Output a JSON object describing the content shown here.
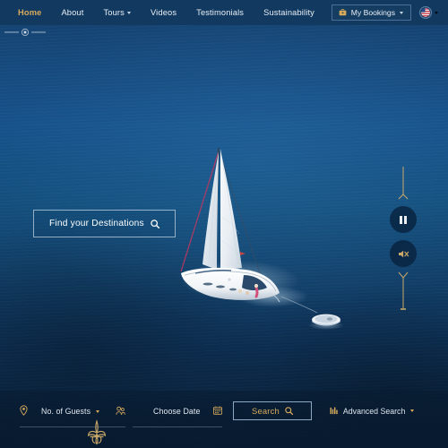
{
  "colors": {
    "nav_bg": "#123a60",
    "accent_gold": "#d6aa5c",
    "text_light": "#e8eef5",
    "ocean_light": "#17538c",
    "ocean_dark": "#0a2340",
    "border_muted": "#4a7099"
  },
  "nav": {
    "items": [
      {
        "label": "Home",
        "active": true,
        "has_dropdown": false
      },
      {
        "label": "About",
        "active": false,
        "has_dropdown": false
      },
      {
        "label": "Tours",
        "active": false,
        "has_dropdown": true
      },
      {
        "label": "Videos",
        "active": false,
        "has_dropdown": false
      },
      {
        "label": "Testimonials",
        "active": false,
        "has_dropdown": false
      },
      {
        "label": "Sustainability",
        "active": false,
        "has_dropdown": false
      }
    ],
    "bookings_label": "My Bookings",
    "bookings_icon": "briefcase-icon",
    "language_icon": "us-flag-icon"
  },
  "hero": {
    "cta_label": "Find your Destinations",
    "cta_icon": "search-icon",
    "image_subject": "aerial view of white sailboat under sail on deep blue ocean towing a dinghy"
  },
  "media_controls": {
    "pause_icon": "pause-icon",
    "sound_icon": "mute-speaker-icon"
  },
  "search": {
    "guests_label": "No. of Guests",
    "guests_icon": "location-pin-icon",
    "guests_trailing_icon": "people-group-icon",
    "date_label": "Choose Date",
    "date_icon": "calendar-icon",
    "search_button_label": "Search",
    "search_button_icon": "search-icon",
    "advanced_label": "Advanced Search",
    "advanced_icon": "sliders-icon"
  },
  "footer": {
    "crest_icon": "fleur-de-lis-ornament"
  }
}
